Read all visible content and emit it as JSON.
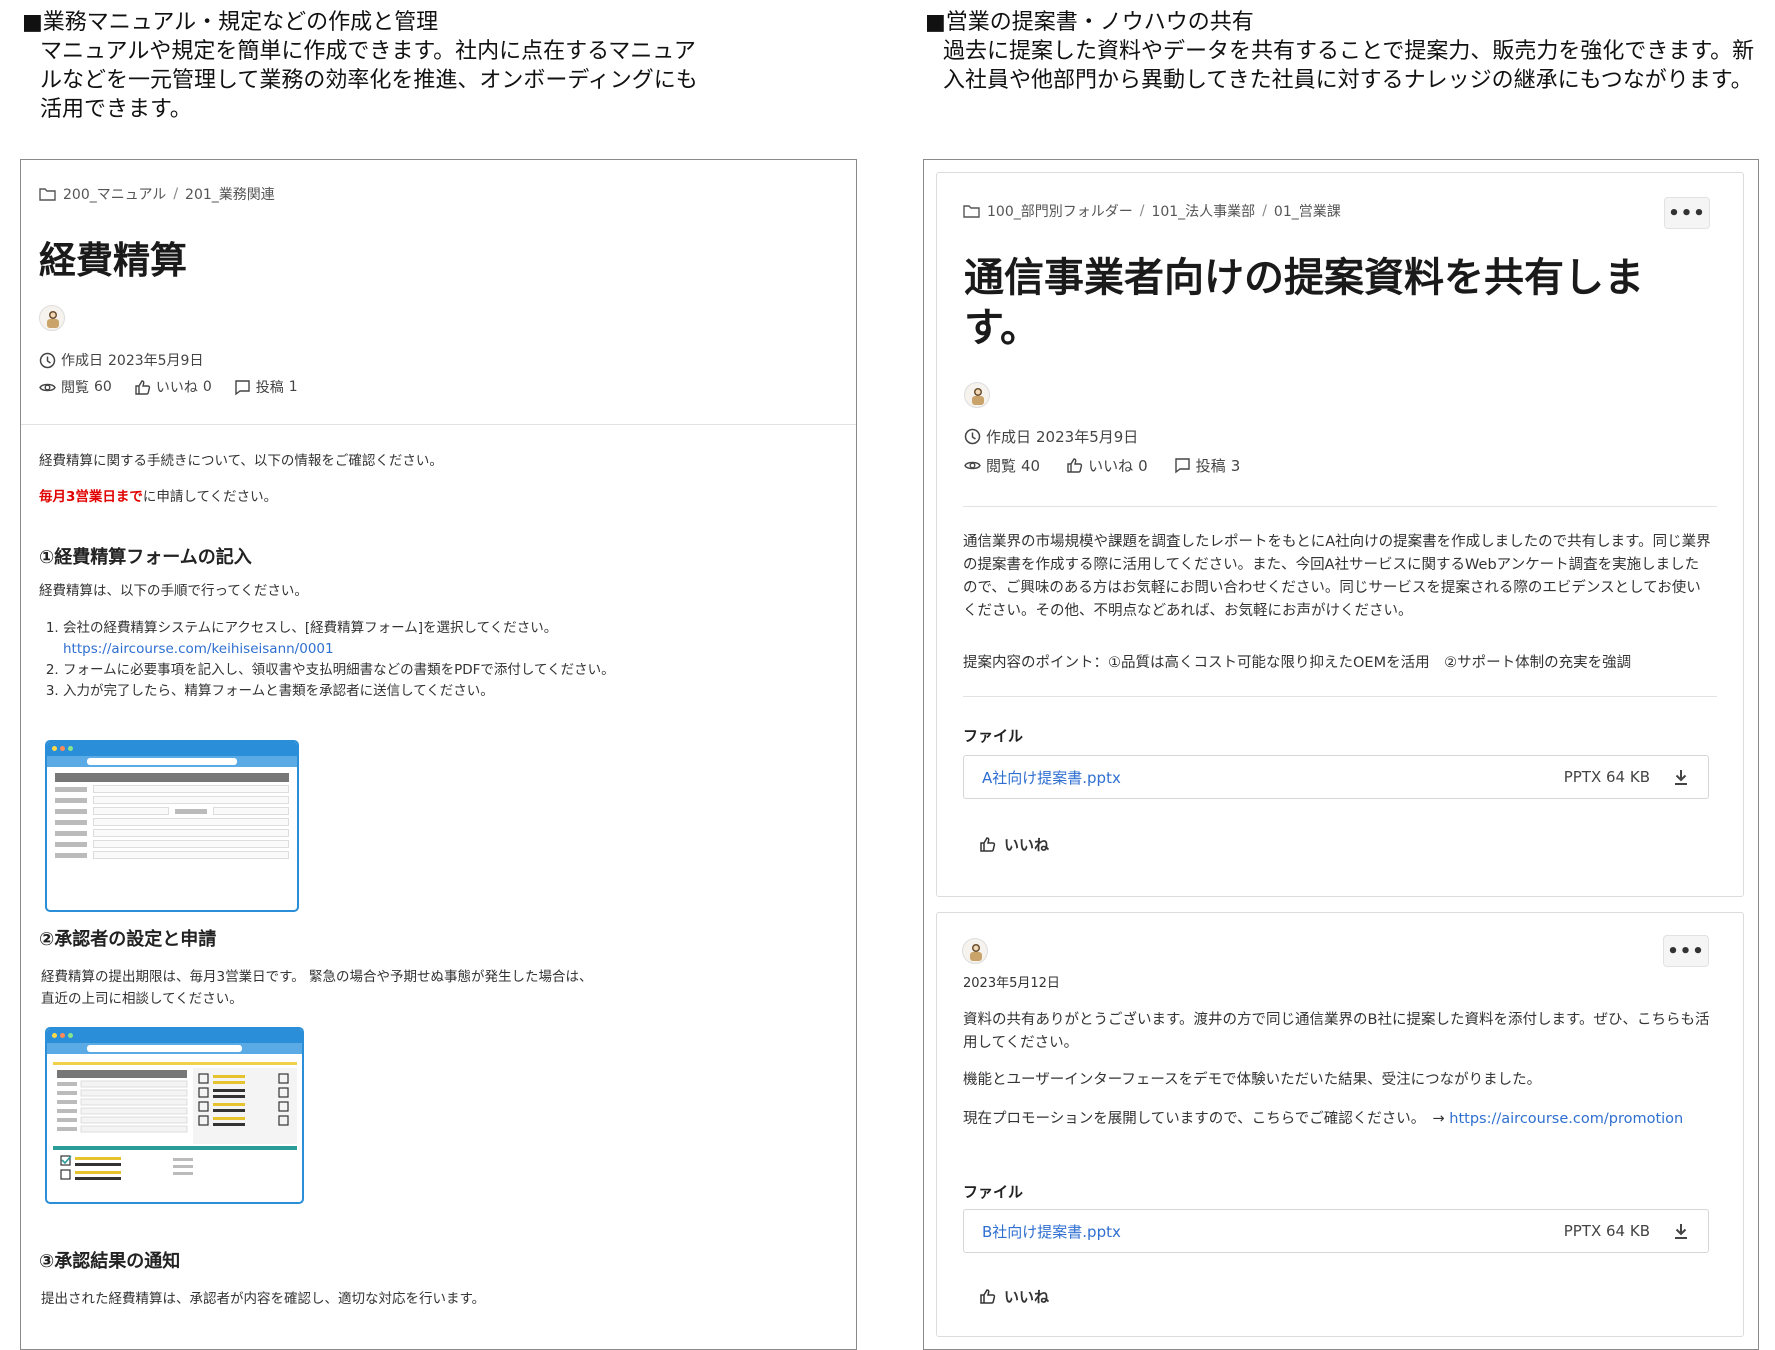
{
  "captions": {
    "left_title": "■業務マニュアル・規定などの作成と管理",
    "left_desc": "マニュアルや規定を簡単に作成できます。社内に点在するマニュアルなどを一元管理して業務の効率化を推進、オンボーディングにも活用できます。",
    "right_title": "■営業の提案書・ノウハウの共有",
    "right_desc": "過去に提案した資料やデータを共有することで提案力、販売力を強化できます。新入社員や他部門から異動してきた社員に対するナレッジの継承にもつながります。"
  },
  "left": {
    "breadcrumb": [
      "200_マニュアル",
      "201_業務関連"
    ],
    "breadcrumb_sep": "/",
    "title": "経費精算",
    "created_label": "作成日",
    "created_date": "2023年5月9日",
    "views_label": "閲覧",
    "views_count": "60",
    "likes_label": "いいね",
    "likes_count": "0",
    "posts_label": "投稿",
    "posts_count": "1",
    "intro": "経費精算に関する手続きについて、以下の情報をご確認ください。",
    "deadline_red": "毎月3営業日まで",
    "deadline_rest": "に申請してください。",
    "section1": "①経費精算フォームの記入",
    "section1_text": "経費精算は、以下の手順で行ってください。",
    "steps": {
      "s1": "会社の経費精算システムにアクセスし、[経費精算フォーム]を選択してください。",
      "s1_link": "https://aircourse.com/keihiseisann/0001",
      "s2": "フォームに必要事項を記入し、領収書や支払明細書などの書類をPDFで添付してください。",
      "s3": "入力が完了したら、精算フォームと書類を承認者に送信してください。"
    },
    "section2": "②承認者の設定と申請",
    "section2_text_1": "経費精算の提出期限は、毎月3営業日です。 緊急の場合や予期せぬ事態が発生した場合は、",
    "section2_text_2": "直近の上司に相談してください。",
    "section3": "③承認結果の通知",
    "section3_text": "提出された経費精算は、承認者が内容を確認し、適切な対応を行います。"
  },
  "right": {
    "breadcrumb": [
      "100_部門別フォルダー",
      "101_法人事業部",
      "01_営業課"
    ],
    "breadcrumb_sep": "/",
    "more": "•••",
    "title": "通信事業者向けの提案資料を共有します。",
    "created_label": "作成日",
    "created_date": "2023年5月9日",
    "views_label": "閲覧",
    "views_count": "40",
    "likes_label": "いいね",
    "likes_count": "0",
    "posts_label": "投稿",
    "posts_count": "3",
    "body": "通信業界の市場規模や課題を調査したレポートをもとにA社向けの提案書を作成しましたので共有します。同じ業界の提案書を作成する際に活用してください。また、今回A社サービスに関するWebアンケート調査を実施しましたので、ご興味のある方はお気軽にお問い合わせください。同じサービスを提案される際のエビデンスとしてお使いください。その他、不明点などあれば、お気軽にお声がけください。",
    "points": "提案内容のポイント：①品質は高くコスト可能な限り抑えたOEMを活用　②サポート体制の充実を強調",
    "files_label": "ファイル",
    "file_name": "A社向け提案書.pptx",
    "file_size": "PPTX 64 KB",
    "like_label": "いいね",
    "comment": {
      "date": "2023年5月12日",
      "more": "•••",
      "text1": "資料の共有ありがとうございます。渡井の方で同じ通信業界のB社に提案した資料を添付します。ぜひ、こちらも活用してください。",
      "text2": "機能とユーザーインターフェースをデモで体験いただいた結果、受注につながりました。",
      "text3": "現在プロモーションを展開していますので、こちらでご確認ください。　→",
      "link": "https://aircourse.com/promotion",
      "files_label": "ファイル",
      "file_name": "B社向け提案書.pptx",
      "file_size": "PPTX 64 KB",
      "like_label": "いいね"
    }
  },
  "icons": [
    "folder-icon",
    "clock-icon",
    "eye-icon",
    "thumbs-up-icon",
    "comment-icon",
    "download-icon",
    "avatar-icon",
    "more-icon"
  ],
  "colors": {
    "link": "#2f6fd0",
    "deadline": "#e00000",
    "illustration": "#2a8fd8"
  }
}
